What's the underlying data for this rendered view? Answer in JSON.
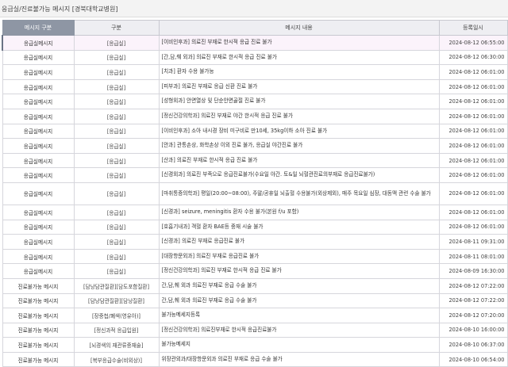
{
  "page": {
    "title": "응급실/진료불가능 메시지 [경북대학교병원]"
  },
  "table": {
    "headers": [
      "메시지 구분",
      "구분",
      "메시지 내용",
      "등록일시"
    ],
    "rows": [
      {
        "type": "응급실메시지",
        "cat": "[응급실]",
        "msg": "[이비인후과] 의료진 부재로 한시적 응급 진료 불가",
        "date": "2024-08-12 06:55:00",
        "selected": true
      },
      {
        "type": "응급실메시지",
        "cat": "[응급실]",
        "msg": "[간,담,췌 외과] 의료진 부재로 한시적 응급 진료 불가",
        "date": "2024-08-12 06:30:00"
      },
      {
        "type": "응급실메시지",
        "cat": "[응급실]",
        "msg": "[치과] 환자 수용 불가능",
        "date": "2024-08-12 06:01:00"
      },
      {
        "type": "응급실메시지",
        "cat": "[응급실]",
        "msg": "[피부과] 의료진 부재로 응급 신환 진료 불가",
        "date": "2024-08-12 06:01:00"
      },
      {
        "type": "응급실메시지",
        "cat": "[응급실]",
        "msg": "[성형외과] 안면열상 및 단순안면골절 진료 불가",
        "date": "2024-08-12 06:01:00"
      },
      {
        "type": "응급실메시지",
        "cat": "[응급실]",
        "msg": "[정신건강의학과] 의료진 부재로 야간 한시적 응급 진료 불가",
        "date": "2024-08-12 06:01:00"
      },
      {
        "type": "응급실메시지",
        "cat": "[응급실]",
        "msg": "[이비인후과] 소아 내시경 장비 미구비로 만10세, 35kg이하 소아 진료 불가",
        "date": "2024-08-12 06:01:00"
      },
      {
        "type": "응급실메시지",
        "cat": "[응급실]",
        "msg": "[안과] 관통손상, 화학손상 이외 진료 불가, 응급실 야간진료 불가",
        "date": "2024-08-12 06:01:00"
      },
      {
        "type": "응급실메시지",
        "cat": "[응급실]",
        "msg": "[산과] 의료진 부재로 한시적 응급 진료 불가",
        "date": "2024-08-12 06:01:00"
      },
      {
        "type": "응급실메시지",
        "cat": "[응급실]",
        "msg": "[신경외과] 의료진 부족으로 응급진료불가(수요일 야간. 토&일 뇌혈관진료의부재로 응급진료불가)",
        "date": "2024-08-12 06:01:00"
      },
      {
        "type": "응급실메시지",
        "cat": "[응급실]",
        "msg": "[마취통증의학과] 평일(20:00~08:00), 주말/공휴일 뇌출혈 수용불가(외상제외), 매주 목요일 심장, 대동맥 관련 수술 불가",
        "date": "2024-08-12 06:01:00",
        "tall": true
      },
      {
        "type": "응급실메시지",
        "cat": "[응급실]",
        "msg": "[신경과] seizure, meningitis 환자 수용 불가(본원 f/u 포함)",
        "date": "2024-08-12 06:01:00"
      },
      {
        "type": "응급실메시지",
        "cat": "[응급실]",
        "msg": "[호흡기내과] 객혈 환자 BAE등 중재 시술 불가",
        "date": "2024-08-12 06:01:00"
      },
      {
        "type": "응급실메시지",
        "cat": "[응급실]",
        "msg": "[신경과] 의료진 부재로 응급진료 불가",
        "date": "2024-08-11 09:31:00"
      },
      {
        "type": "응급실메시지",
        "cat": "[응급실]",
        "msg": "[대장항문외과] 의료진 부재로 응급진료 불가",
        "date": "2024-08-11 08:01:00"
      },
      {
        "type": "응급실메시지",
        "cat": "[응급실]",
        "msg": "[정신건강의학과] 의료진 부재로 한시적 응급 진료 불가",
        "date": "2024-08-09 16:30:00"
      },
      {
        "type": "진료불가능 메시지",
        "cat": "[담낭담관질환][담도포함질환]",
        "msg": "간,담,췌 외과 의료진 부재로 응급 수술 불가",
        "date": "2024-08-12 07:22:00"
      },
      {
        "type": "진료불가능 메시지",
        "cat": "[담낭담관질환][담낭질환]",
        "msg": "간,담,췌 외과 의료진 부재로 응급 수술 불가",
        "date": "2024-08-12 07:22:00"
      },
      {
        "type": "진료불가능 메시지",
        "cat": "[장중첩/폐색(영유아)]",
        "msg": "불가능메세지등록",
        "date": "2024-08-12 07:20:00"
      },
      {
        "type": "진료불가능 메시지",
        "cat": "[정신과적 응급입원]",
        "msg": "[정신건강의학과] 의료진부재로 한시적 응급진료불가",
        "date": "2024-08-10 16:00:00"
      },
      {
        "type": "진료불가능 메시지",
        "cat": "[뇌경색의 재관류중재술]",
        "msg": "불가능메세지",
        "date": "2024-08-10 06:37:00"
      },
      {
        "type": "진료불가능 메시지",
        "cat": "[복부응급수술(비외상)]",
        "msg": "위장관외과/대장항문외과 의료진 부재로 응급 수술 불가",
        "date": "2024-08-10 06:54:00"
      }
    ]
  }
}
